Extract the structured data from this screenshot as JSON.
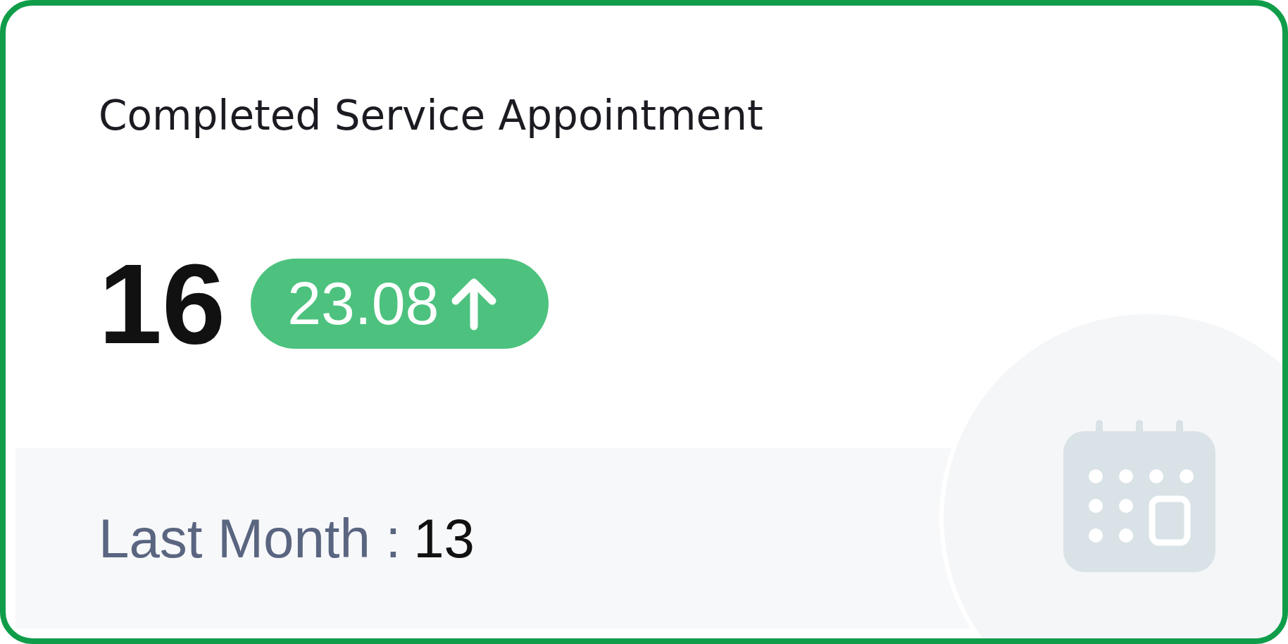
{
  "card": {
    "title": "Completed Service Appointment",
    "value": "16",
    "change": {
      "text": "23.08",
      "up": true
    },
    "comparison": {
      "label": "Last Month :",
      "value": "13"
    }
  }
}
